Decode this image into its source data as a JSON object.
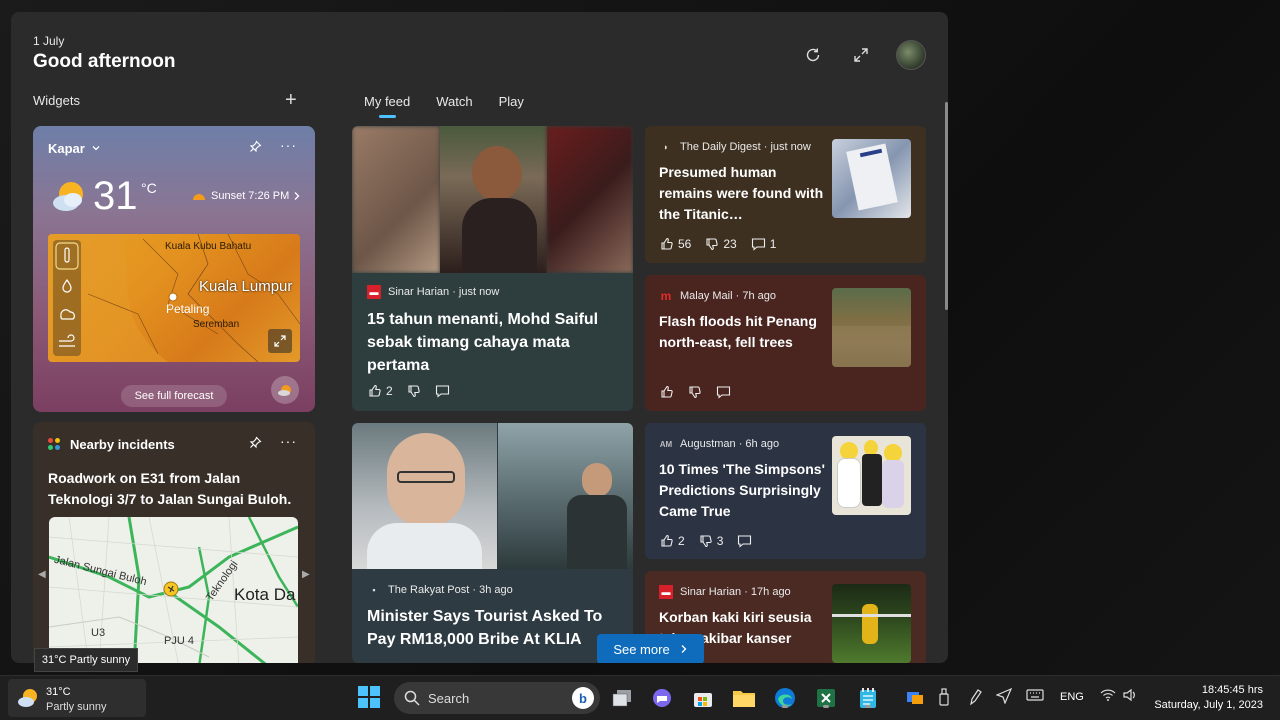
{
  "header": {
    "date": "1 July",
    "greeting": "Good afternoon"
  },
  "widgets": {
    "label": "Widgets",
    "add": "+"
  },
  "tabs": [
    {
      "label": "My feed"
    },
    {
      "label": "Watch"
    },
    {
      "label": "Play"
    }
  ],
  "weather": {
    "location": "Kapar",
    "temperature": "31",
    "unit": "°C",
    "sunset": "Sunset 7:26 PM",
    "map_labels": [
      "Kuala Kubu Bahatu",
      "Kuala Lumpur",
      "Petaling",
      "Seremban"
    ],
    "forecast_button": "See full forecast"
  },
  "incidents": {
    "title": "Nearby incidents",
    "text": "Roadwork on E31 from Jalan Teknologi 3/7 to Jalan Sungai Buloh.",
    "map_labels": [
      "Jalan Sungai Buloh",
      "Teknologi",
      "Kota Da",
      "U3",
      "PJU 4"
    ]
  },
  "feed": [
    {
      "source": "Sinar Harian · just now",
      "headline": "15 tahun menanti, Mohd Saiful sebak timang cahaya mata pertama",
      "likes": "2",
      "dislikes": "",
      "comments": ""
    },
    {
      "source": "The Daily Digest · just now",
      "headline": "Presumed human remains were found with the Titanic…",
      "likes": "56",
      "dislikes": "23",
      "comments": "1"
    },
    {
      "source": "Malay Mail · 7h ago",
      "headline": "Flash floods hit Penang north-east, fell trees",
      "likes": "",
      "dislikes": "",
      "comments": ""
    },
    {
      "source": "The Rakyat Post · 3h ago",
      "headline": "Minister Says Tourist Asked To Pay RM18,000 Bribe At KLIA"
    },
    {
      "source": "Augustman · 6h ago",
      "headline": "10 Times 'The Simpsons' Predictions Surprisingly Came True",
      "likes": "2",
      "dislikes": "3",
      "comments": ""
    },
    {
      "source": "Sinar Harian · 17h ago",
      "headline": "Korban kaki kiri seusia tahun akibar kanser tulang"
    }
  ],
  "see_more": "See more",
  "tooltip": "31°C Partly sunny",
  "taskbar": {
    "weather_temp": "31°C",
    "weather_cond": "Partly sunny",
    "search_placeholder": "Search",
    "language": "ENG",
    "time": "18:45:45 hrs",
    "date": "Saturday, July 1, 2023"
  },
  "colors": {
    "accent": "#4cc2ff",
    "see_more_bg": "#0f6cbd",
    "panel_bg": "#2b2b2b"
  }
}
